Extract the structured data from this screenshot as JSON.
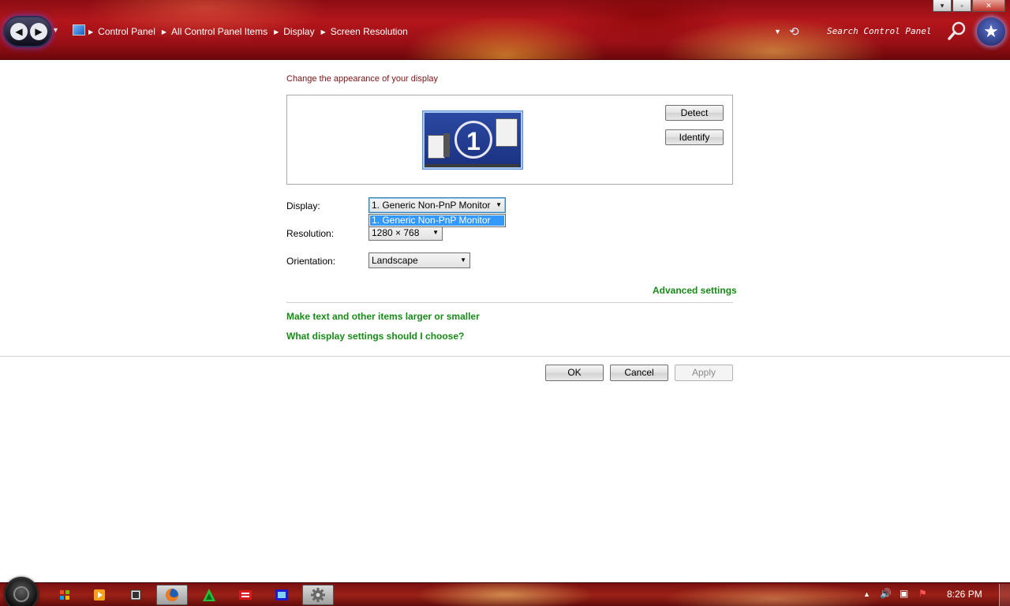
{
  "window": {
    "breadcrumbs": [
      "Control Panel",
      "All Control Panel Items",
      "Display",
      "Screen Resolution"
    ],
    "search_placeholder": "Search Control Panel",
    "controls": {
      "minimize": "▾",
      "maximize": "▫",
      "close": "✕"
    }
  },
  "content": {
    "heading": "Change the appearance of your display",
    "detect_label": "Detect",
    "identify_label": "Identify",
    "monitor_number": "1",
    "display_label": "Display:",
    "display_value": "1. Generic Non-PnP Monitor",
    "display_options": [
      "1. Generic Non-PnP Monitor"
    ],
    "resolution_label": "Resolution:",
    "resolution_value": "1280 × 768",
    "orientation_label": "Orientation:",
    "orientation_value": "Landscape",
    "advanced_settings": "Advanced settings",
    "link_text_size": "Make text and other items larger or smaller",
    "link_help": "What display settings should I choose?",
    "ok_label": "OK",
    "cancel_label": "Cancel",
    "apply_label": "Apply"
  },
  "taskbar": {
    "icons": [
      "windows-explorer",
      "media-player",
      "app-window",
      "firefox",
      "green-triangle-app",
      "red-app",
      "blue-app",
      "settings-gear"
    ],
    "tray": [
      "show-hidden-icons",
      "volume",
      "network",
      "action-center"
    ],
    "time": "8:26 PM"
  },
  "colors": {
    "heading": "#7a1313",
    "link_green": "#178b17",
    "selection_blue": "#3399ff",
    "titlebar_red": "#b3161b"
  }
}
